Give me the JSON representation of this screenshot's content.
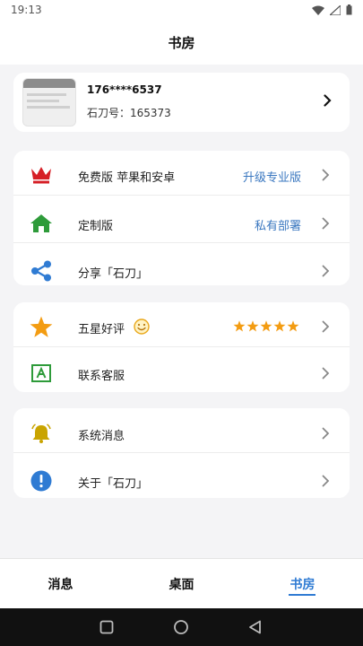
{
  "status_bar": {
    "time": "19:13"
  },
  "header": {
    "title": "书房"
  },
  "profile": {
    "phone": "176****6537",
    "account_id": "石刀号：165373"
  },
  "features": [
    {
      "icon": "crown-icon",
      "label": "免费版 苹果和安卓",
      "action": "升级专业版"
    },
    {
      "icon": "home-icon",
      "label": "定制版",
      "action": "私有部署"
    },
    {
      "icon": "share-icon",
      "label": "分享「石刀」"
    }
  ],
  "reviews": [
    {
      "icon": "star-icon",
      "label": "五星好评",
      "rating": 5,
      "rating_max": 5
    },
    {
      "icon": "customer-service-icon",
      "label": "联系客服"
    }
  ],
  "system": [
    {
      "icon": "bell-icon",
      "label": "系统消息"
    },
    {
      "icon": "info-icon",
      "label": "关于「石刀」"
    }
  ],
  "nav": {
    "tabs": [
      {
        "label": "消息"
      },
      {
        "label": "桌面"
      },
      {
        "label": "书房"
      }
    ],
    "active": 2
  },
  "colors": {
    "accent": "#2f7bd3",
    "crown": "#d61f26",
    "home": "#2e9b3a",
    "share": "#2f7bd3",
    "star": "#f39c12",
    "bell": "#c9a400",
    "info": "#2f7bd3"
  }
}
